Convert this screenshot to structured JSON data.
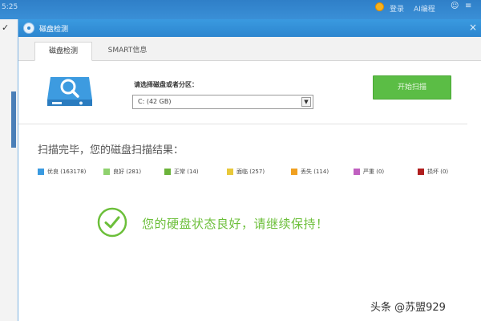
{
  "desktop": {
    "clock": "5:25",
    "tray_text_1": "登录",
    "tray_text_2": "AI编程"
  },
  "window": {
    "title": "磁盘检测",
    "tabs": [
      {
        "label": "磁盘检测",
        "active": true
      },
      {
        "label": "SMART信息",
        "active": false
      }
    ]
  },
  "select": {
    "label": "请选择磁盘或者分区：",
    "value": "C:  (42 GB)"
  },
  "scan_button": "开始扫描",
  "result": {
    "heading": "扫描完毕，您的磁盘扫描结果：",
    "legend": [
      {
        "label": "优良 (163178)",
        "color": "#3a9ae0"
      },
      {
        "label": "良好 (281)",
        "color": "#8fd16e"
      },
      {
        "label": "正常 (14)",
        "color": "#6bb33a"
      },
      {
        "label": "面临 (257)",
        "color": "#e8c83a"
      },
      {
        "label": "丢失 (114)",
        "color": "#f0a020"
      },
      {
        "label": "严重 (0)",
        "color": "#c060c0"
      },
      {
        "label": "损坏 (0)",
        "color": "#b01e1e"
      }
    ],
    "status": "您的硬盘状态良好，请继续保持！"
  },
  "watermark": "头条 @苏盟929",
  "colors": {
    "titlebar": "#2d86cf",
    "accent_green": "#5bbd45",
    "status_green": "#6cbf3a"
  },
  "icons": [
    "app-icon",
    "disk-magnifier-icon",
    "dropdown-arrow-icon",
    "check-circle-icon",
    "close-icon"
  ]
}
